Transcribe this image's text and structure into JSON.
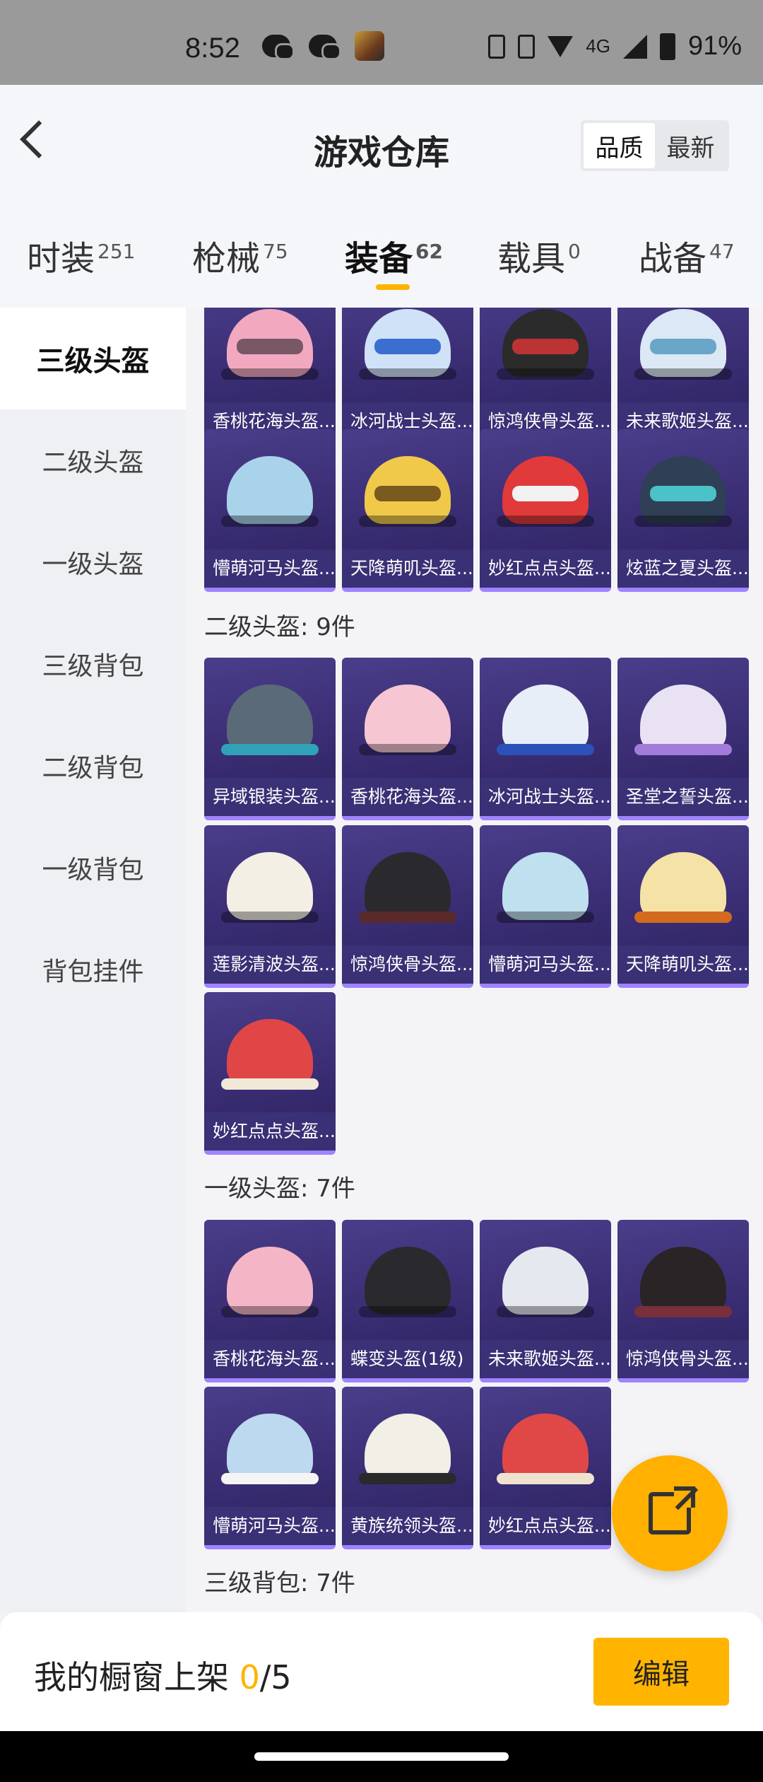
{
  "status_bar": {
    "time": "8:52",
    "network": "4G",
    "battery": "91%"
  },
  "header": {
    "title": "游戏仓库",
    "sort_quality": "品质",
    "sort_newest": "最新"
  },
  "tabs": [
    {
      "label": "时装",
      "count": "251"
    },
    {
      "label": "枪械",
      "count": "75"
    },
    {
      "label": "装备",
      "count": "62"
    },
    {
      "label": "载具",
      "count": "0"
    },
    {
      "label": "战备",
      "count": "47"
    }
  ],
  "sidebar": [
    "三级头盔",
    "二级头盔",
    "一级头盔",
    "三级背包",
    "二级背包",
    "一级背包",
    "背包挂件"
  ],
  "sections": {
    "level3": {
      "items_row1": [
        "香桃花海头盔...",
        "冰河战士头盔...",
        "惊鸿侠骨头盔...",
        "未来歌姬头盔..."
      ],
      "items_row2": [
        "懵萌河马头盔...",
        "天降萌叽头盔...",
        "妙红点点头盔...",
        "炫蓝之夏头盔..."
      ]
    },
    "level2": {
      "title": "二级头盔: 9件",
      "items": [
        "异域银装头盔...",
        "香桃花海头盔...",
        "冰河战士头盔...",
        "圣堂之誓头盔...",
        "莲影清波头盔...",
        "惊鸿侠骨头盔...",
        "懵萌河马头盔...",
        "天降萌叽头盔...",
        "妙红点点头盔..."
      ]
    },
    "level1": {
      "title": "一级头盔: 7件",
      "items": [
        "香桃花海头盔...",
        "蝶变头盔(1级)",
        "未来歌姬头盔...",
        "惊鸿侠骨头盔...",
        "懵萌河马头盔...",
        "黄族统领头盔...",
        "妙红点点头盔..."
      ]
    },
    "backpack3": {
      "title": "三级背包: 7件"
    }
  },
  "bottom_bar": {
    "label": "我的橱窗上架 ",
    "count": "0",
    "total": "/5",
    "edit_label": "编辑"
  }
}
